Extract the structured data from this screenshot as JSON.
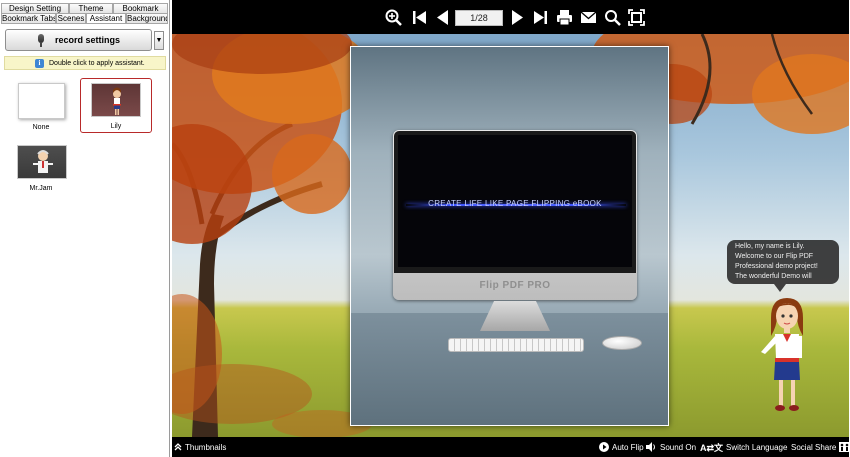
{
  "tabs": {
    "row1": [
      "Design Setting",
      "Theme",
      "Bookmark"
    ],
    "row2": [
      "Bookmark Tabs",
      "Scenes",
      "Assistant",
      "Background"
    ]
  },
  "assistant_panel": {
    "record_button": "record settings",
    "dropdown_glyph": "▼",
    "hint": "Double click to apply assistant.",
    "items": [
      {
        "name": "None"
      },
      {
        "name": "Lily"
      },
      {
        "name": "Mr.Jam"
      }
    ]
  },
  "viewer": {
    "page_indicator": "1/28",
    "screen_text": "CREATE LIFE LIKE PAGE FLIPPING eBOOK",
    "monitor_logo": "Flip PDF PRO",
    "bubble_text": "Hello, my name is Lily. Welcome to our Flip PDF Professional demo project! The wonderful Demo will",
    "bottom": {
      "thumbnails": "Thumbnails",
      "auto_flip": "Auto Flip",
      "sound": "Sound On",
      "switch_language": "Switch Language",
      "social_share": "Social Share"
    }
  },
  "colors": {
    "selected_border": "#b82a2a",
    "hint_bg": "#f8f5c9",
    "toolbar_bg": "#000000"
  },
  "icons": [
    "zoom-in-icon",
    "first-page-icon",
    "prev-page-icon",
    "next-page-icon",
    "last-page-icon",
    "print-icon",
    "email-icon",
    "search-icon",
    "fullscreen-icon",
    "mic-icon",
    "info-icon",
    "thumbnails-icon",
    "play-icon",
    "sound-icon",
    "language-icon",
    "share-icon"
  ]
}
